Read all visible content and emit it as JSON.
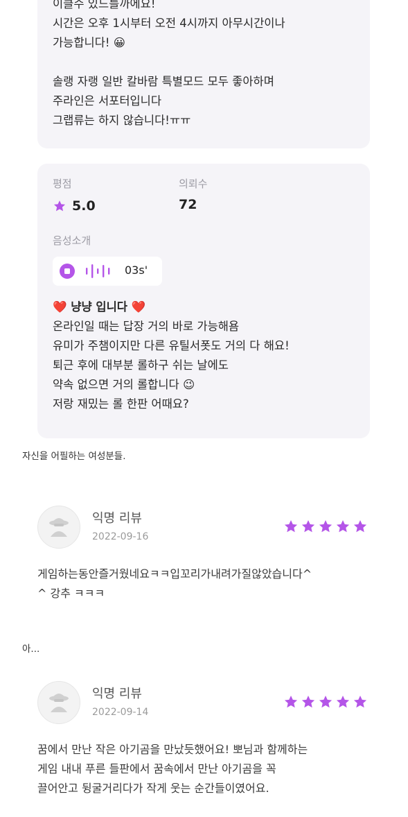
{
  "card_intro": {
    "lines": [
      "이클수 있드를까에요!",
      "시간은 오후 1시부터 오전 4시까지 아무시간이나",
      "가능합니다! 😀",
      "",
      "솔랭 자랭 일반 칼바람 특별모드 모두 좋아하며",
      "주라인은 서포터입니다",
      "그랩류는 하지 않습니다!ㅠㅠ"
    ]
  },
  "card_profile": {
    "rating_label": "평점",
    "rating_value": "5.0",
    "requests_label": "의뢰수",
    "requests_value": "72",
    "voice_label": "음성소개",
    "voice_duration": "03s'",
    "bio_lines": [
      "❤️ 냥냥 입니다 ❤️",
      "온라인일 때는 답장 거의 바로 가능해욤",
      "유미가 주챔이지만 다른 유틸서폿도 거의 다 해요!",
      "퇴근 후에 대부분 롤하구 쉬는 날에도",
      "약속 없으면 거의 롤합니다 😉",
      "저랑 재밌는 롤 한판 어때요?"
    ]
  },
  "caption1": "자신을 어필하는 여성분들.",
  "caption2": "아...",
  "reviews": [
    {
      "name": "익명 리뷰",
      "date": "2022-09-16",
      "rating": 5,
      "text": "게임하는동안즐거웠네요ㅋㅋ입꼬리가내려가질않았습니다^\n^ 강추 ㅋㅋㅋ"
    },
    {
      "name": "익명 리뷰",
      "date": "2022-09-14",
      "rating": 5,
      "text": "꿈에서 만난 작은 아기곰을 만났듯했어요! 뽀님과 함께하는\n게임 내내 푸른 들판에서 꿈속에서 만난 아기곰을 꼭\n끌어안고 뒹굴거리다가 작게 웃는 순간들이였어요."
    }
  ],
  "colors": {
    "accent": "#b455e8",
    "card_bg": "#f5f4f8",
    "heart": "#d8323b"
  }
}
